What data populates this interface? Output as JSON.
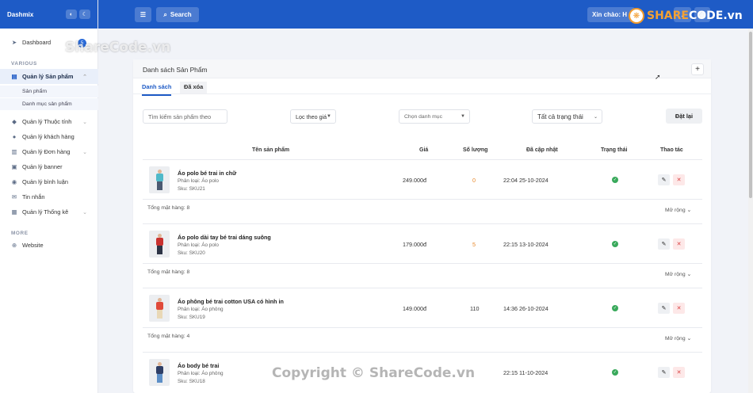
{
  "app": {
    "brand": "Dashmix"
  },
  "sidebar": {
    "dashboard": "Dashboard",
    "dashboard_badge": "5",
    "section_various": "VARIOUS",
    "products": "Quản lý Sản phẩm",
    "products_sub": [
      "Sản phẩm",
      "Danh mục sản phẩm"
    ],
    "attributes": "Quản lý Thuộc tính",
    "customers": "Quản lý khách hàng",
    "orders": "Quản lý Đơn hàng",
    "banner": "Quản lý banner",
    "comments": "Quản lý bình luận",
    "messages": "Tin nhắn",
    "stats": "Quản lý Thống kê",
    "section_more": "MORE",
    "website": "Website"
  },
  "topbar": {
    "search": "Search",
    "greeting": "Xin chào: H"
  },
  "card": {
    "title": "Danh sách Sản Phẩm",
    "add": "+"
  },
  "tabs": [
    "Danh sách",
    "Đã xóa"
  ],
  "filters": {
    "search_placeholder": "Tìm kiếm sản phẩm theo",
    "price_filter": "Lọc theo giá",
    "category": "Chọn danh mục",
    "status": "Tất cả trạng thái",
    "reset": "Đặt lại"
  },
  "table": {
    "headers": [
      "Tên sản phẩm",
      "Giá",
      "Số lượng",
      "Đã cập nhật",
      "Trạng thái",
      "Thao tác"
    ],
    "rows": [
      {
        "name": "Áo polo bé trai in chữ",
        "category": "Phân loại: Áo polo",
        "sku": "Sku: SKU21",
        "price": "249.000đ",
        "qty": "0",
        "updated": "22:04 25-10-2024",
        "total": "Tổng mặt hàng: 8",
        "more": "Mở rộng"
      },
      {
        "name": "Áo polo dài tay bé trai dáng suông",
        "category": "Phân loại: Áo polo",
        "sku": "Sku: SKU20",
        "price": "179.000đ",
        "qty": "5",
        "updated": "22:15 13-10-2024",
        "total": "Tổng mặt hàng: 8",
        "more": "Mở rộng"
      },
      {
        "name": "Áo phông bé trai cotton USA có hình in",
        "category": "Phân loại: Áo phông",
        "sku": "Sku: SKU19",
        "price": "149.000đ",
        "qty": "110",
        "updated": "14:36 26-10-2024",
        "total": "Tổng mặt hàng: 4",
        "more": "Mở rộng"
      },
      {
        "name": "Áo body bé trai",
        "category": "Phân loại: Áo phông",
        "sku": "Sku: SKU18",
        "price": "",
        "qty": "",
        "updated": "22:15 11-10-2024",
        "total": "",
        "more": ""
      }
    ]
  },
  "watermarks": {
    "top": "ShareCode.vn",
    "bottom": "Copyright © ShareCode.vn",
    "logo_a": "SHARE",
    "logo_b": "CODE.vn"
  },
  "colors": {
    "primary": "#1e5bc6",
    "status_ok": "#39a95b",
    "delete": "#d94040"
  }
}
